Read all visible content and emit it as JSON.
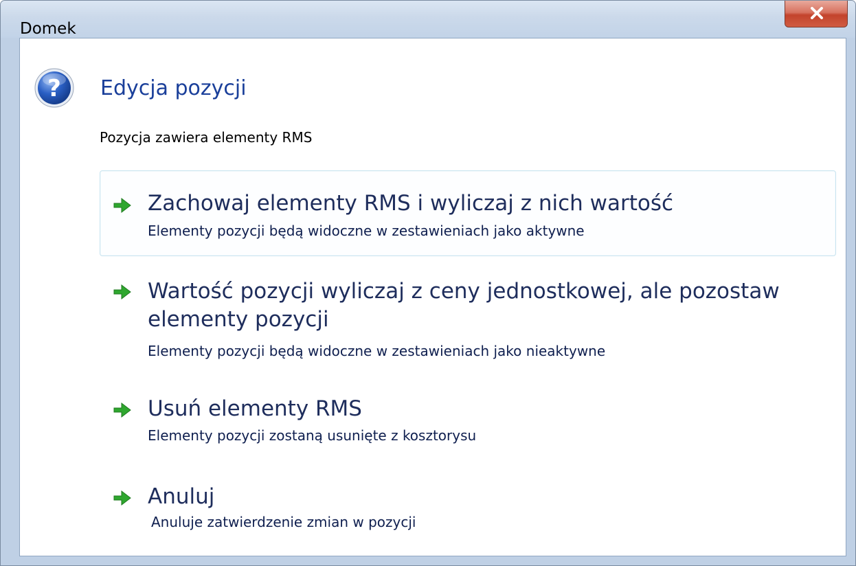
{
  "window": {
    "title": "Domek",
    "close_label": "close"
  },
  "dialog": {
    "heading": "Edycja pozycji",
    "description": "Pozycja zawiera elementy RMS"
  },
  "options": [
    {
      "title": "Zachowaj elementy RMS i wyliczaj z nich wartość",
      "subtitle": "Elementy pozycji będą widoczne w zestawieniach jako aktywne"
    },
    {
      "title": "Wartość pozycji wyliczaj z ceny jednostkowej, ale pozostaw elementy pozycji",
      "subtitle": "Elementy pozycji będą widoczne w zestawieniach jako nieaktywne"
    },
    {
      "title": "Usuń elementy RMS",
      "subtitle": "Elementy pozycji zostaną usunięte z kosztorysu"
    },
    {
      "title": "Anuluj",
      "subtitle": "Anuluje zatwierdzenie zmian w pozycji"
    }
  ],
  "colors": {
    "heading": "#1a3f9a",
    "option_text": "#1e2d5c",
    "arrow": "#2fa72f",
    "close_button": "#c3432c"
  },
  "icons": {
    "dialog": "question-mark-icon",
    "option": "green-arrow-icon",
    "close": "close-x-icon"
  }
}
